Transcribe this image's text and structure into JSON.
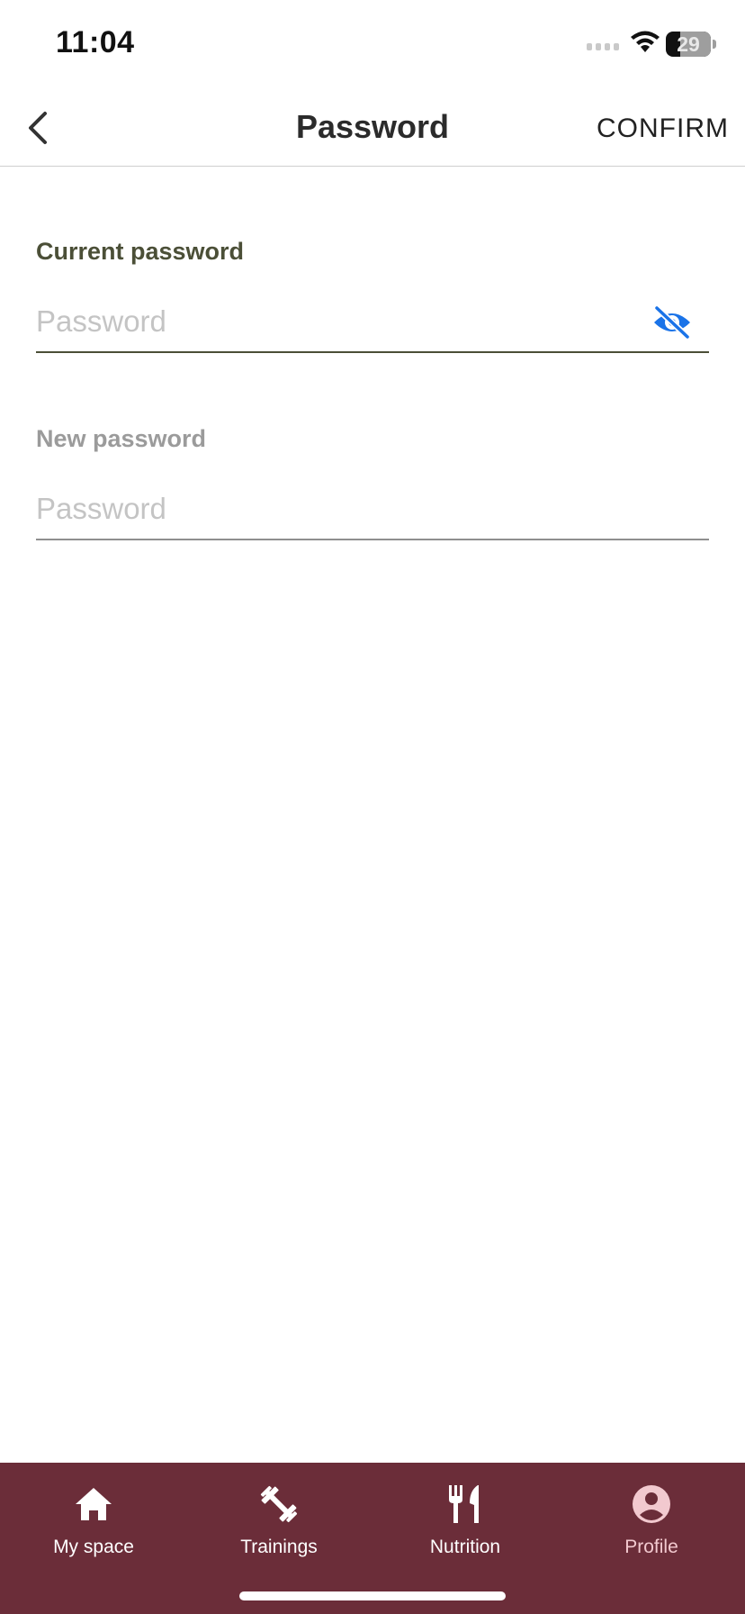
{
  "status_bar": {
    "time": "11:04",
    "battery": "29"
  },
  "nav": {
    "title": "Password",
    "confirm_label": "CONFIRM"
  },
  "form": {
    "current": {
      "label": "Current password",
      "placeholder": "Password"
    },
    "new": {
      "label": "New password",
      "placeholder": "Password"
    }
  },
  "tabs": [
    {
      "label": "My space",
      "icon": "home-icon"
    },
    {
      "label": "Trainings",
      "icon": "dumbbell-icon"
    },
    {
      "label": "Nutrition",
      "icon": "fork-knife-icon"
    },
    {
      "label": "Profile",
      "icon": "profile-icon"
    }
  ],
  "colors": {
    "accent_label": "#4b4f37",
    "eye_icon": "#1a73e8",
    "tabbar_bg": "#6b2d39",
    "active_tab": "#f2c9cf"
  }
}
